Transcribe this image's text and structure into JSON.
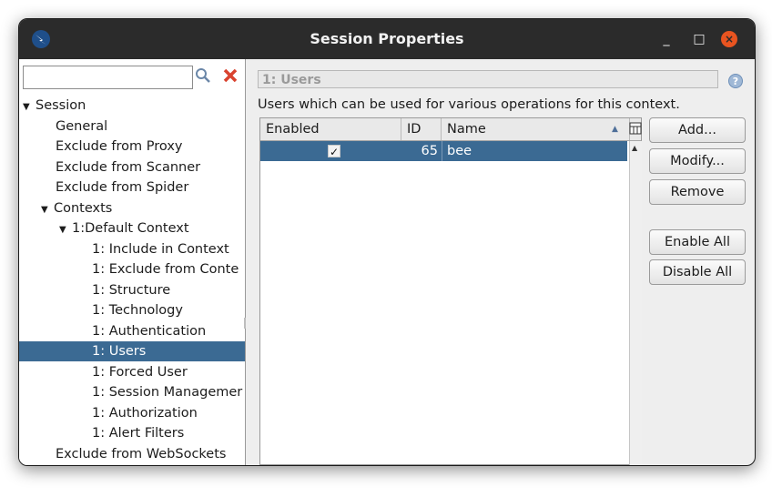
{
  "window": {
    "title": "Session Properties"
  },
  "window_controls": {
    "minimize": "_",
    "maximize": "□",
    "close": "×"
  },
  "search": {
    "value": "",
    "placeholder": ""
  },
  "tree": {
    "items": [
      {
        "label": "Session",
        "level": 0,
        "expanded": true
      },
      {
        "label": "General",
        "level": 1
      },
      {
        "label": "Exclude from Proxy",
        "level": 1
      },
      {
        "label": "Exclude from Scanner",
        "level": 1
      },
      {
        "label": "Exclude from Spider",
        "level": 1
      },
      {
        "label": "Contexts",
        "level": 1,
        "expanded": true
      },
      {
        "label": "1:Default Context",
        "level": 2,
        "expanded": true
      },
      {
        "label": "1: Include in Context",
        "level": 3
      },
      {
        "label": "1: Exclude from Conte",
        "level": 3
      },
      {
        "label": "1: Structure",
        "level": 3
      },
      {
        "label": "1: Technology",
        "level": 3
      },
      {
        "label": "1: Authentication",
        "level": 3
      },
      {
        "label": "1: Users",
        "level": 3,
        "selected": true
      },
      {
        "label": "1: Forced User",
        "level": 3
      },
      {
        "label": "1: Session Managemer",
        "level": 3
      },
      {
        "label": "1: Authorization",
        "level": 3
      },
      {
        "label": "1: Alert Filters",
        "level": 3
      },
      {
        "label": "Exclude from WebSockets",
        "level": 1
      }
    ]
  },
  "panel": {
    "header": "1: Users",
    "description": "Users which can be used for various operations for this context."
  },
  "table": {
    "columns": [
      "Enabled",
      "ID",
      "Name"
    ],
    "rows": [
      {
        "enabled": "✓",
        "id": "65",
        "name": "bee"
      }
    ]
  },
  "buttons": {
    "add": "Add...",
    "modify": "Modify...",
    "remove": "Remove",
    "enable_all": "Enable All",
    "disable_all": "Disable All"
  },
  "colors": {
    "selection": "#3b6a93",
    "titlebar": "#2b2b2b",
    "close": "#e95420"
  }
}
